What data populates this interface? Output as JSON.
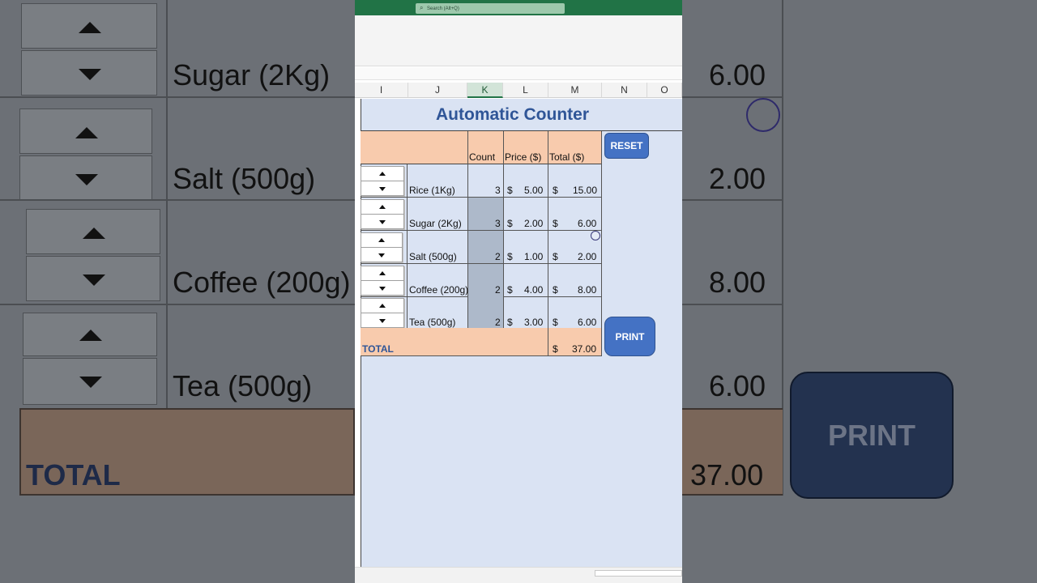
{
  "app": {
    "search_placeholder": "Search (Alt+Q)"
  },
  "columns": [
    "I",
    "J",
    "K",
    "L",
    "M",
    "N",
    "O"
  ],
  "selected_column": "K",
  "sheet": {
    "title": "Automatic Counter",
    "headers": {
      "count": "Count",
      "price": "Price ($)",
      "total": "Total ($)"
    },
    "currency_symbol": "$",
    "items": [
      {
        "name": "Rice (1Kg)",
        "count": "3",
        "price": "5.00",
        "total": "15.00"
      },
      {
        "name": "Sugar (2Kg)",
        "count": "3",
        "price": "2.00",
        "total": "6.00"
      },
      {
        "name": "Salt (500g)",
        "count": "2",
        "price": "1.00",
        "total": "2.00"
      },
      {
        "name": "Coffee (200g)",
        "count": "2",
        "price": "4.00",
        "total": "8.00"
      },
      {
        "name": "Tea (500g)",
        "count": "2",
        "price": "3.00",
        "total": "6.00"
      }
    ],
    "total_label": "TOTAL",
    "grand_total": "37.00"
  },
  "buttons": {
    "reset": "RESET",
    "print": "PRINT"
  },
  "background_zoom": {
    "items": [
      "Sugar (2Kg)",
      "Salt (500g)",
      "Coffee (200g)",
      "Tea (500g)"
    ],
    "values": [
      "6.00",
      "2.00",
      "8.00",
      "6.00"
    ],
    "total_label": "TOTAL",
    "total_value": "37.00",
    "print_label": "PRINT"
  },
  "colors": {
    "excel_green": "#217346",
    "sheet_bg": "#dae3f3",
    "header_peach": "#f8cbad",
    "title_blue": "#2f5597",
    "button_blue": "#4472c4",
    "count_cell_gray": "#adb9ca"
  }
}
